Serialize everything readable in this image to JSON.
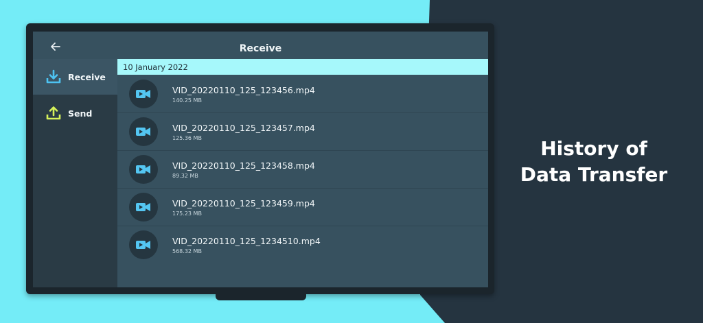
{
  "promo": {
    "line1": "History of",
    "line2": "Data Transfer"
  },
  "colors": {
    "background_cyan": "#74ecf7",
    "dark_panel": "#253440",
    "screen_bg": "#37515f",
    "sidebar_bg": "#2a3b45",
    "date_bar": "#a6f8fb",
    "receive_icon": "#4dc3f2",
    "send_icon": "#d6f25a",
    "video_icon": "#54c6f2"
  },
  "header": {
    "title": "Receive",
    "back_icon": "arrow-left-icon"
  },
  "sidebar": {
    "items": [
      {
        "label": "Receive",
        "icon": "download-icon",
        "active": true
      },
      {
        "label": "Send",
        "icon": "upload-icon",
        "active": false
      }
    ]
  },
  "date_group": "10 January 2022",
  "files": [
    {
      "name": "VID_20220110_125_123456.mp4",
      "size": "140.25 MB"
    },
    {
      "name": "VID_20220110_125_123457.mp4",
      "size": "125.36 MB"
    },
    {
      "name": "VID_20220110_125_123458.mp4",
      "size": "89.32 MB"
    },
    {
      "name": "VID_20220110_125_123459.mp4",
      "size": "175.23 MB"
    },
    {
      "name": "VID_20220110_125_1234510.mp4",
      "size": "568.32 MB"
    }
  ]
}
